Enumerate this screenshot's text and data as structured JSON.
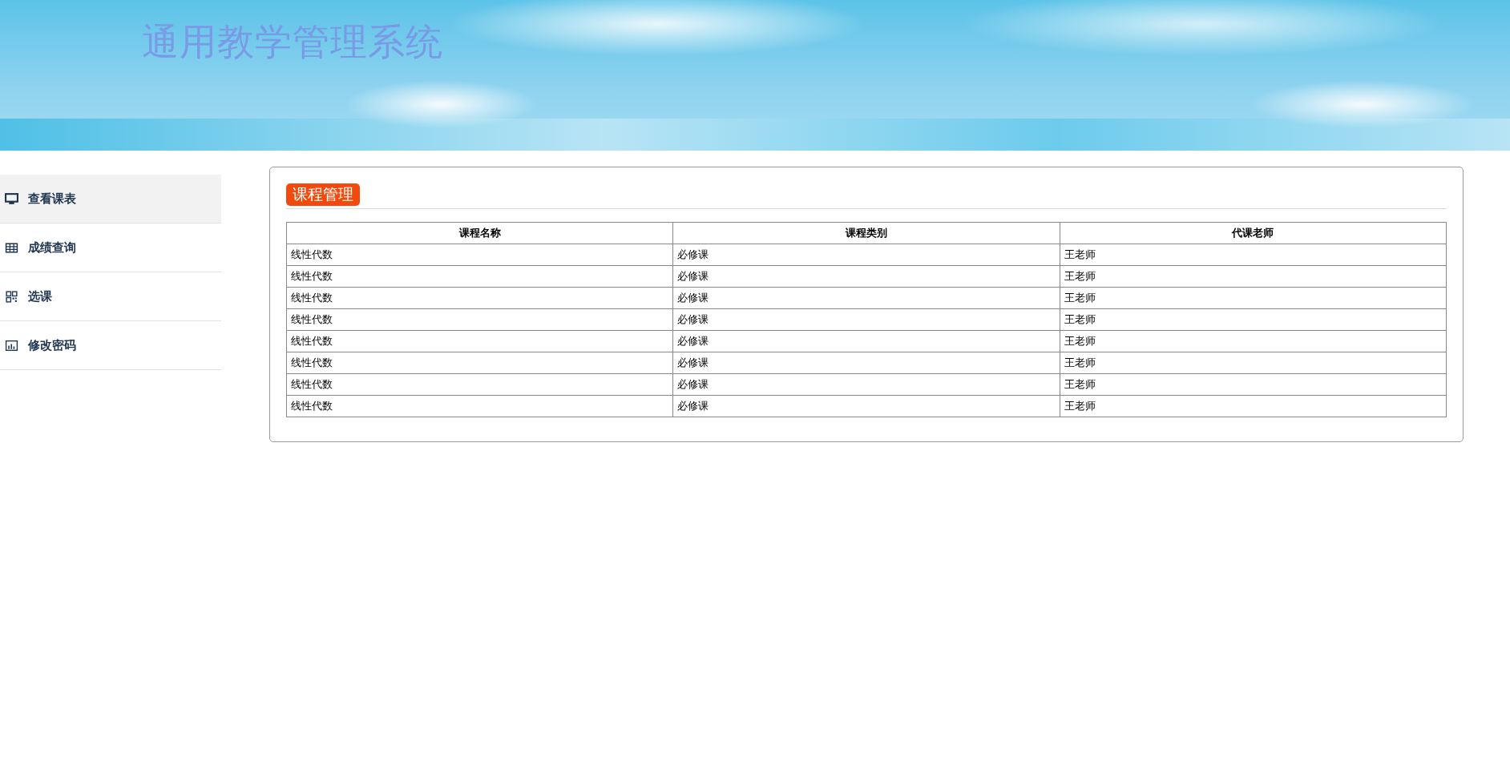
{
  "header": {
    "title": "通用教学管理系统"
  },
  "sidebar": {
    "items": [
      {
        "label": "查看课表",
        "kind": "monitor",
        "selected": true
      },
      {
        "label": "成绩查询",
        "kind": "table",
        "selected": false
      },
      {
        "label": "选课",
        "kind": "grid",
        "selected": false
      },
      {
        "label": "修改密码",
        "kind": "chart",
        "selected": false
      }
    ]
  },
  "panel": {
    "title": "课程管理",
    "table": {
      "columns": [
        "课程名称",
        "课程类别",
        "代课老师"
      ],
      "rows": [
        [
          "线性代数",
          "必修课",
          "王老师"
        ],
        [
          "线性代数",
          "必修课",
          "王老师"
        ],
        [
          "线性代数",
          "必修课",
          "王老师"
        ],
        [
          "线性代数",
          "必修课",
          "王老师"
        ],
        [
          "线性代数",
          "必修课",
          "王老师"
        ],
        [
          "线性代数",
          "必修课",
          "王老师"
        ],
        [
          "线性代数",
          "必修课",
          "王老师"
        ],
        [
          "线性代数",
          "必修课",
          "王老师"
        ]
      ]
    }
  }
}
